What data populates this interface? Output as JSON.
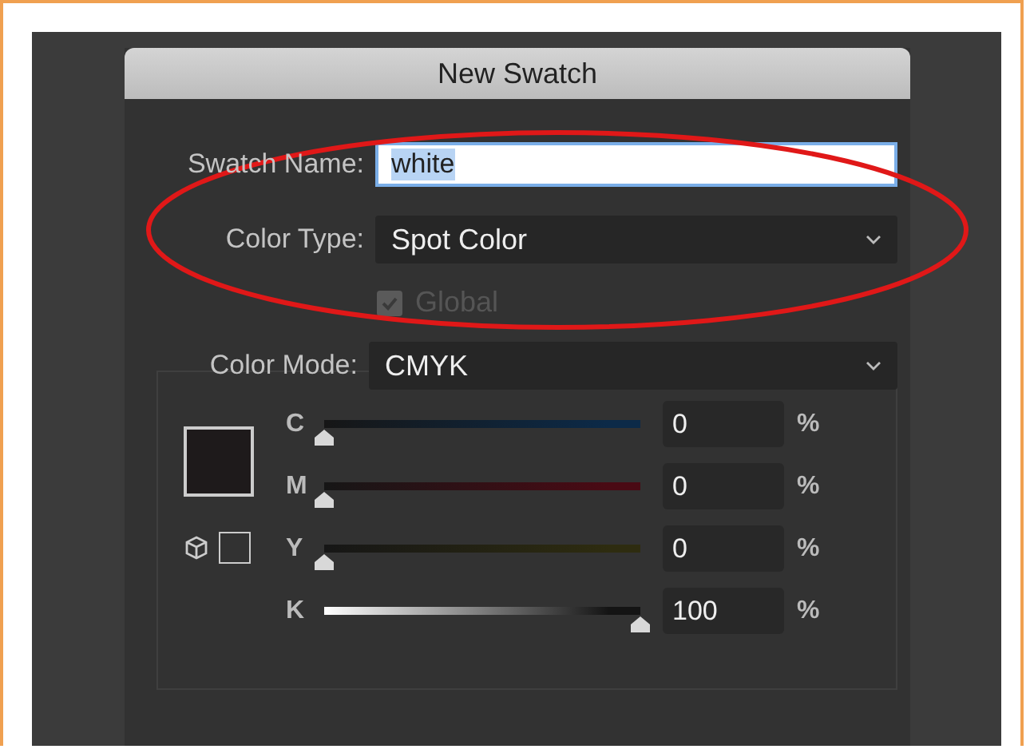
{
  "window": {
    "title": "New Swatch"
  },
  "swatch_name": {
    "label": "Swatch Name:",
    "value": "white"
  },
  "color_type": {
    "label": "Color Type:",
    "value": "Spot Color"
  },
  "global": {
    "label": "Global",
    "checked": true,
    "disabled": true
  },
  "color_mode": {
    "label": "Color Mode:",
    "value": "CMYK"
  },
  "preview": {
    "color": "#1e1a1b"
  },
  "channels": [
    {
      "name": "C",
      "level": 0,
      "value": "0",
      "unit": "%",
      "color": "#0c2a48"
    },
    {
      "name": "M",
      "level": 0,
      "value": "0",
      "unit": "%",
      "color": "#4a0a14"
    },
    {
      "name": "Y",
      "level": 0,
      "value": "0",
      "unit": "%",
      "color": "#2e2c10"
    },
    {
      "name": "K",
      "level": 1,
      "value": "100",
      "unit": "%",
      "color": "#141414"
    }
  ]
}
